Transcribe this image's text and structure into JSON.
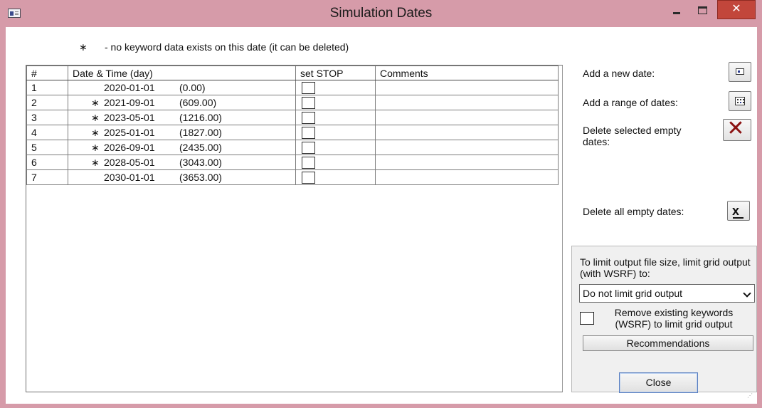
{
  "window": {
    "title": "Simulation Dates",
    "close_glyph": "✕"
  },
  "legend": {
    "marker": "∗",
    "text": "- no keyword data exists on this date (it can be deleted)"
  },
  "table": {
    "headers": [
      "#",
      "Date & Time (day)",
      "set STOP",
      "Comments"
    ],
    "rows": [
      {
        "num": "1",
        "marker": "",
        "date": "2020-01-01",
        "days": "(0.00)",
        "stop": false,
        "comment": ""
      },
      {
        "num": "2",
        "marker": "∗",
        "date": "2021-09-01",
        "days": "(609.00)",
        "stop": false,
        "comment": ""
      },
      {
        "num": "3",
        "marker": "∗",
        "date": "2023-05-01",
        "days": "(1216.00)",
        "stop": false,
        "comment": ""
      },
      {
        "num": "4",
        "marker": "∗",
        "date": "2025-01-01",
        "days": "(1827.00)",
        "stop": false,
        "comment": ""
      },
      {
        "num": "5",
        "marker": "∗",
        "date": "2026-09-01",
        "days": "(2435.00)",
        "stop": false,
        "comment": ""
      },
      {
        "num": "6",
        "marker": "∗",
        "date": "2028-05-01",
        "days": "(3043.00)",
        "stop": false,
        "comment": ""
      },
      {
        "num": "7",
        "marker": "",
        "date": "2030-01-01",
        "days": "(3653.00)",
        "stop": false,
        "comment": ""
      }
    ]
  },
  "actions": {
    "add_date": "Add a new date:",
    "add_range": "Add a range of dates:",
    "delete_selected": "Delete selected empty dates:",
    "delete_all": "Delete all empty dates:",
    "delete_all_glyph": "x"
  },
  "output_limit": {
    "description": "To limit output file size, limit grid output (with WSRF) to:",
    "selected": "Do not limit grid output",
    "remove_keywords_label": "Remove existing keywords (WSRF) to limit grid output",
    "remove_keywords_checked": false,
    "recommendations_label": "Recommendations"
  },
  "close_label": "Close",
  "colors": {
    "titlebar": "#d69ba9",
    "close_button": "#c2463b",
    "delete_icon": "#8b1212"
  },
  "icons": [
    "app-icon",
    "minimize-icon",
    "maximize-icon",
    "close-icon",
    "calendar-add-icon",
    "calendar-range-icon",
    "delete-x-icon",
    "delete-all-icon",
    "chevron-down-icon"
  ]
}
